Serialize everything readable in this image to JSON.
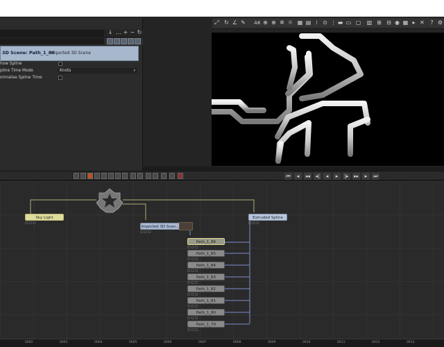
{
  "left_panel": {
    "header_title": "3D Scene: Path_1_86",
    "header_subtitle": "Imported 3D Scene",
    "properties": [
      {
        "label": "how Spline",
        "type": "checkbox"
      },
      {
        "label": "pline Time Mode",
        "type": "select",
        "value": "Knots"
      },
      {
        "label": "ormalise Spline Time",
        "type": "checkbox"
      }
    ]
  },
  "nodes": {
    "sky_light": "Sky Light",
    "imported_scene": "Imported 3D Scen...",
    "extruded_spline": "Extruded Spline",
    "paths": [
      "Path_1_86",
      "Path_1_85",
      "Path_1_84",
      "Path_1_83",
      "Path_1_82",
      "Path_1_81",
      "Path_1_80",
      "Path_1_79"
    ]
  },
  "timeline": {
    "ticks": [
      "0002",
      "0003",
      "0004",
      "0005",
      "0006",
      "0007",
      "0008",
      "0009",
      "0010",
      "0011",
      "0012",
      "0013"
    ]
  },
  "colors": {
    "header_bg": "#a7b7cc",
    "sky_node": "#e0dc9c",
    "scene_node": "#aab9d0",
    "path_node": "#8a8a8a",
    "link": "#7f8fd0"
  }
}
